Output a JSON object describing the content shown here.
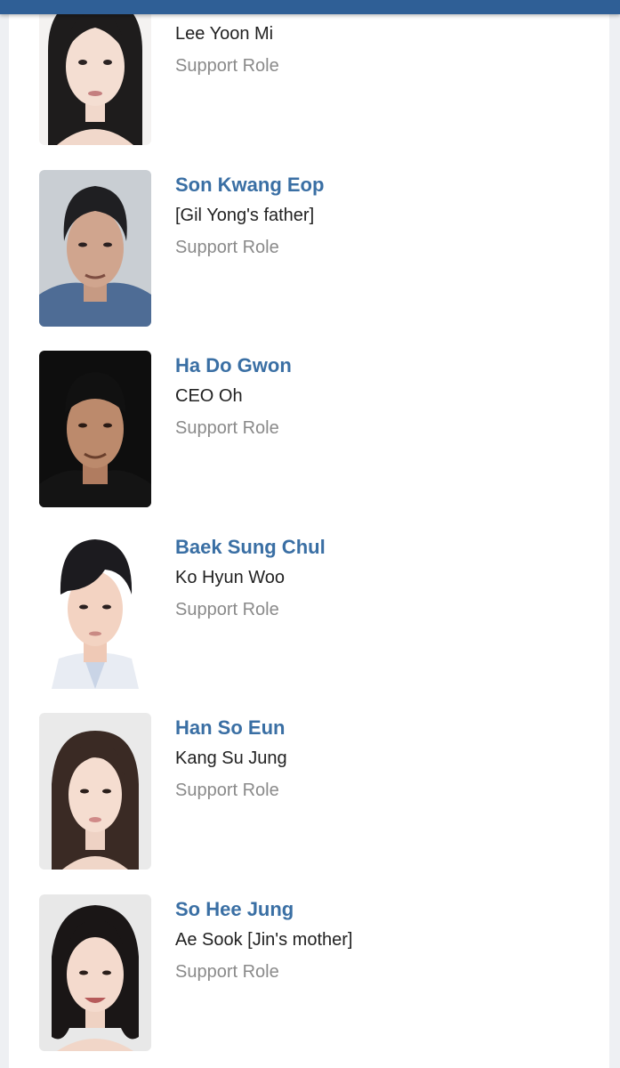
{
  "colors": {
    "top_bar": "#2f5f96",
    "actor_link": "#3a6fa4",
    "role_text": "#222222",
    "role_type": "#8a8a8a",
    "page_background": "#eef0f3"
  },
  "cast": [
    {
      "actor": "",
      "character": "Lee Yoon Mi",
      "role_type": "Support Role",
      "photo": "portrait-photo"
    },
    {
      "actor": "Son Kwang Eop",
      "character": "[Gil Yong's father]",
      "role_type": "Support Role",
      "photo": "portrait-photo"
    },
    {
      "actor": "Ha Do Gwon",
      "character": "CEO Oh",
      "role_type": "Support Role",
      "photo": "portrait-photo"
    },
    {
      "actor": "Baek Sung Chul",
      "character": "Ko Hyun Woo",
      "role_type": "Support Role",
      "photo": "portrait-photo"
    },
    {
      "actor": "Han So Eun",
      "character": "Kang Su Jung",
      "role_type": "Support Role",
      "photo": "portrait-photo"
    },
    {
      "actor": "So Hee Jung",
      "character": "Ae Sook [Jin's mother]",
      "role_type": "Support Role",
      "photo": "portrait-photo"
    }
  ]
}
